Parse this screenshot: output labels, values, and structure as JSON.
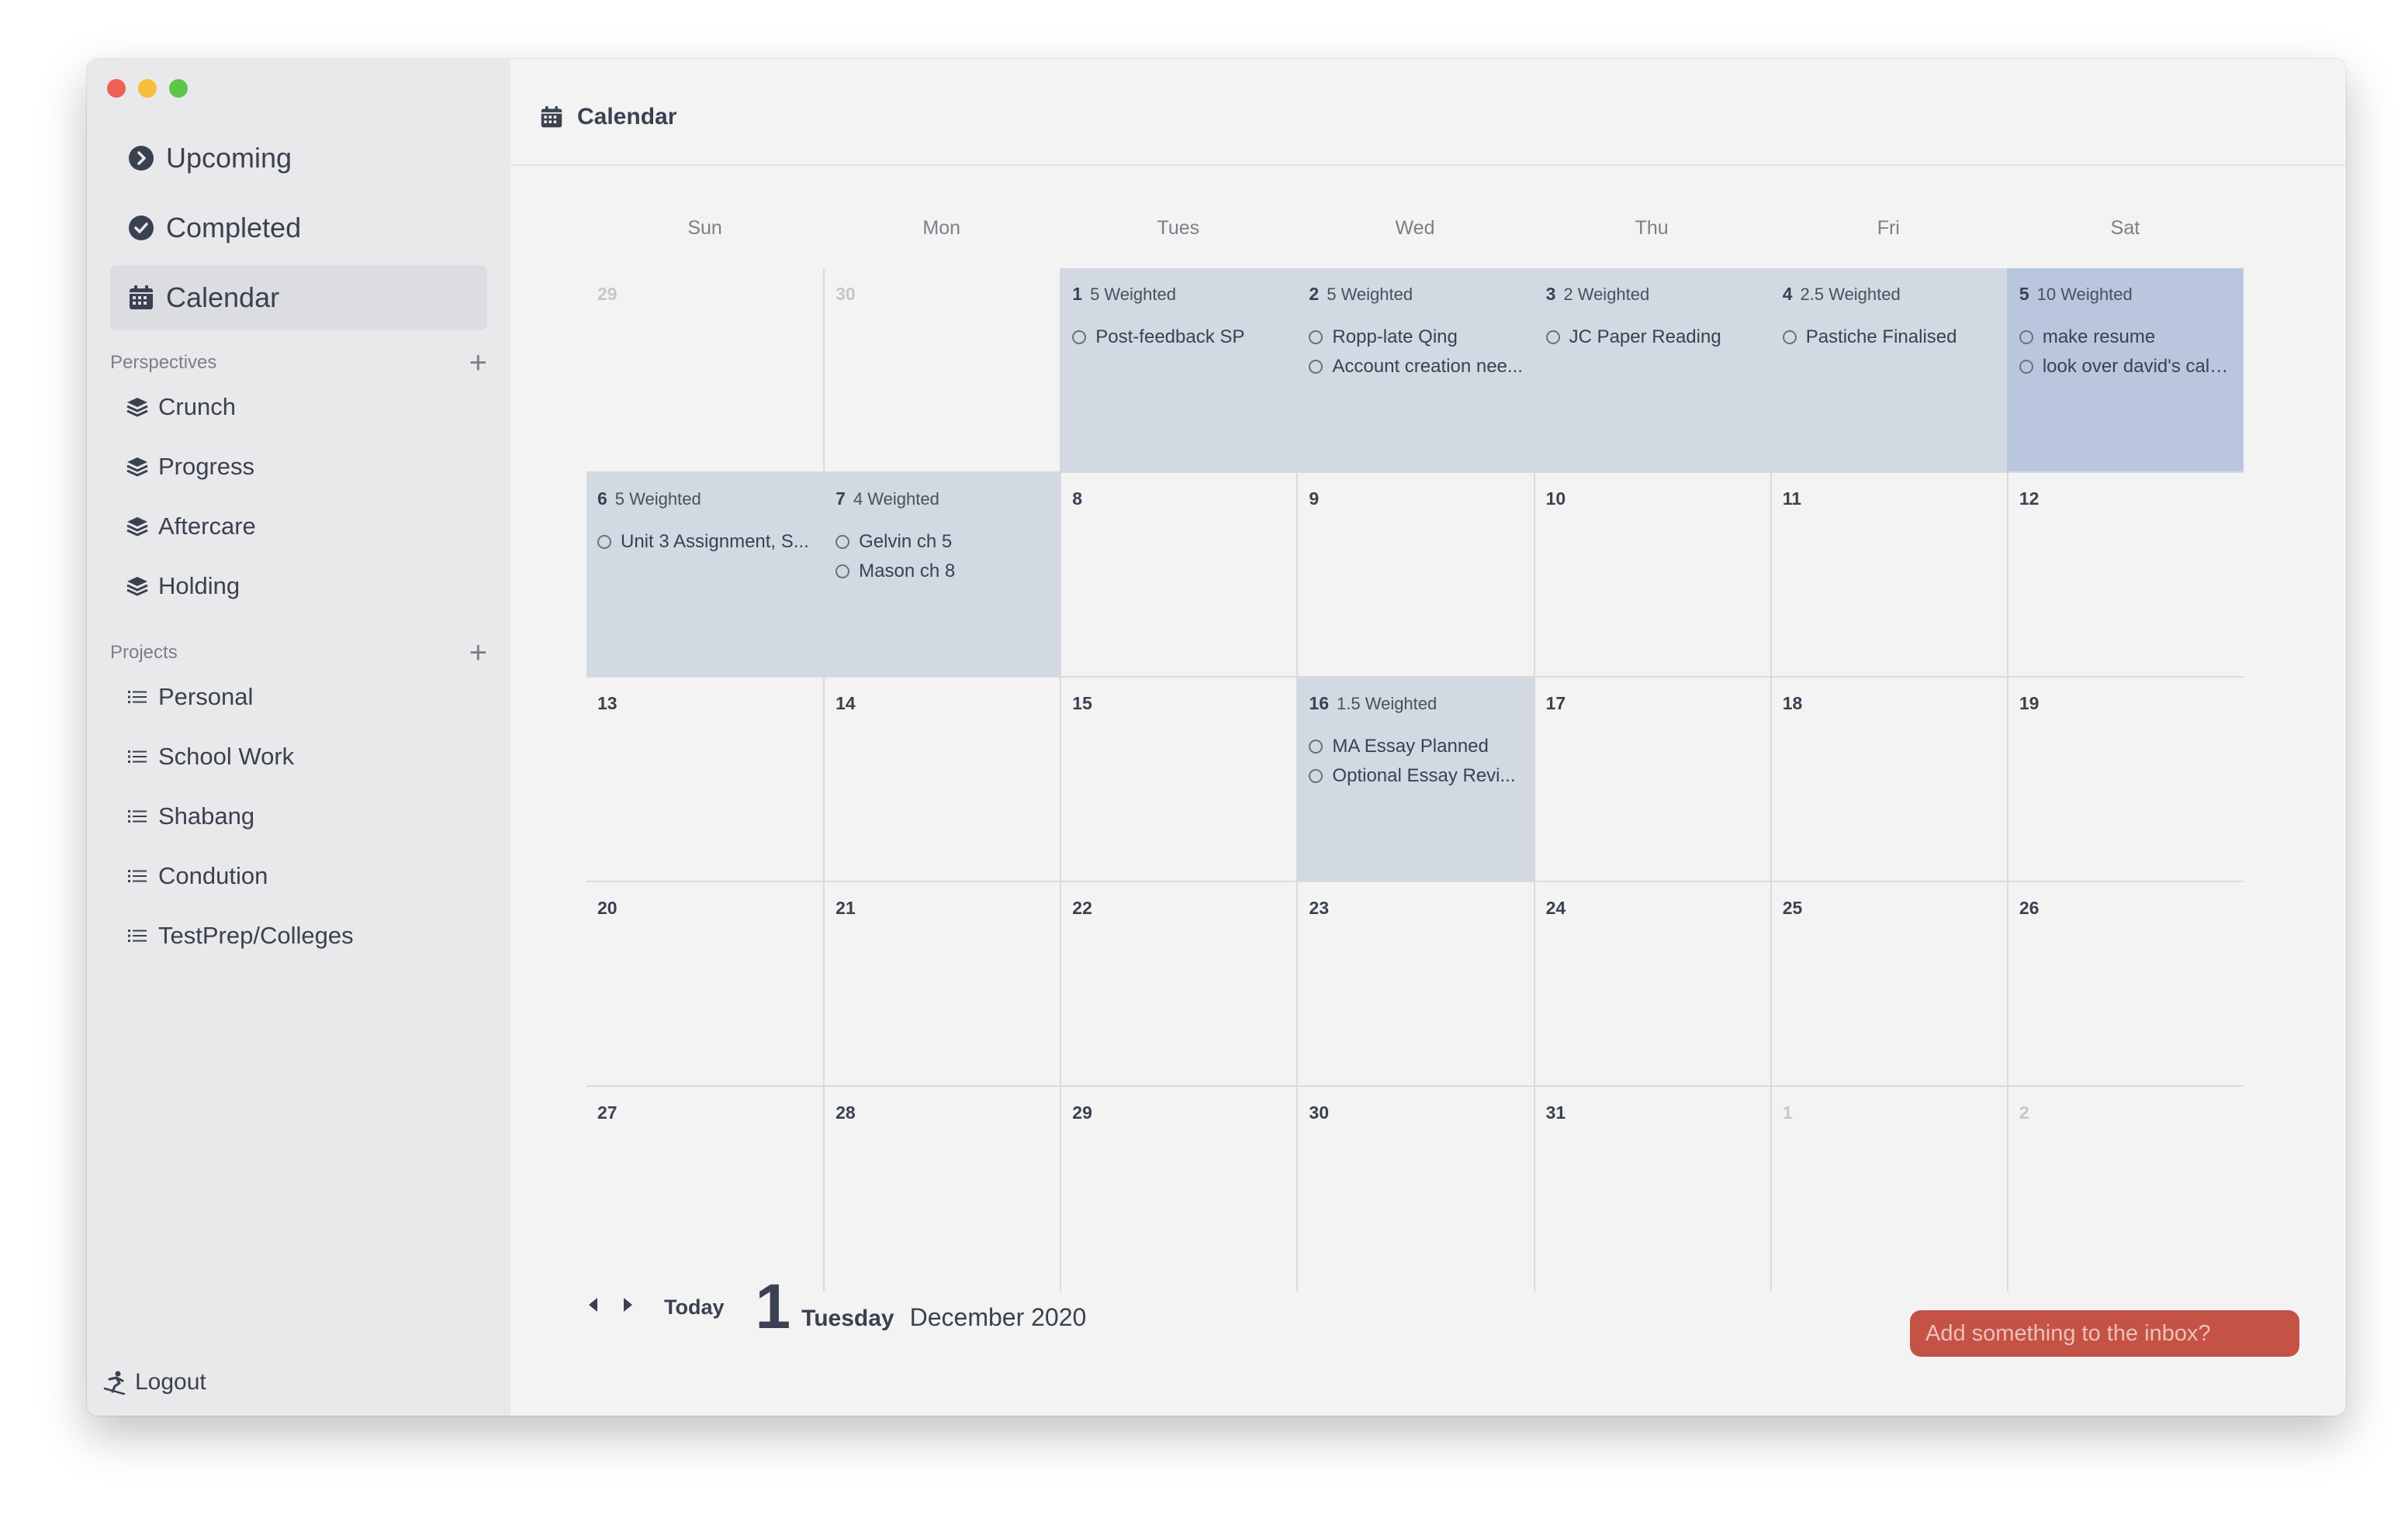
{
  "colors": {
    "accent": "#c45245",
    "sidebar_bg": "#e9e9eb",
    "weighted_cell": "#d3d9e2",
    "heavy_cell": "#b9c6de"
  },
  "sidebar": {
    "main_nav": [
      {
        "label": "Upcoming",
        "icon": "chevron-right-circle-icon"
      },
      {
        "label": "Completed",
        "icon": "check-circle-icon"
      },
      {
        "label": "Calendar",
        "icon": "calendar-icon",
        "active": true
      }
    ],
    "perspectives_heading": "Perspectives",
    "perspectives": [
      {
        "label": "Crunch",
        "icon": "layers-icon"
      },
      {
        "label": "Progress",
        "icon": "layers-icon"
      },
      {
        "label": "Aftercare",
        "icon": "layers-icon"
      },
      {
        "label": "Holding",
        "icon": "layers-icon"
      }
    ],
    "projects_heading": "Projects",
    "projects": [
      {
        "label": "Personal",
        "icon": "list-icon"
      },
      {
        "label": "School Work",
        "icon": "list-icon"
      },
      {
        "label": "Shabang",
        "icon": "list-icon"
      },
      {
        "label": "Condution",
        "icon": "list-icon"
      },
      {
        "label": "TestPrep/Colleges",
        "icon": "list-icon"
      }
    ],
    "logout_label": "Logout"
  },
  "header": {
    "title": "Calendar"
  },
  "calendar": {
    "weekdays": [
      "Sun",
      "Mon",
      "Tues",
      "Wed",
      "Thu",
      "Fri",
      "Sat"
    ],
    "weeks": [
      [
        {
          "day": "29",
          "muted": true
        },
        {
          "day": "30",
          "muted": true
        },
        {
          "day": "1",
          "weight": "5 Weighted",
          "level": 1,
          "tasks": [
            "Post-feedback SP"
          ]
        },
        {
          "day": "2",
          "weight": "5 Weighted",
          "level": 1,
          "tasks": [
            "Ropp-late Qing",
            "Account creation nee..."
          ]
        },
        {
          "day": "3",
          "weight": "2 Weighted",
          "level": 1,
          "tasks": [
            "JC Paper Reading"
          ]
        },
        {
          "day": "4",
          "weight": "2.5 Weighted",
          "level": 1,
          "tasks": [
            "Pastiche Finalised"
          ]
        },
        {
          "day": "5",
          "weight": "10 Weighted",
          "level": 2,
          "tasks": [
            "make resume",
            "look over david's calc..."
          ]
        }
      ],
      [
        {
          "day": "6",
          "weight": "5 Weighted",
          "level": 1,
          "tasks": [
            "Unit 3 Assignment, S..."
          ]
        },
        {
          "day": "7",
          "weight": "4 Weighted",
          "level": 1,
          "tasks": [
            "Gelvin ch 5",
            "Mason ch 8"
          ]
        },
        {
          "day": "8"
        },
        {
          "day": "9"
        },
        {
          "day": "10"
        },
        {
          "day": "11"
        },
        {
          "day": "12"
        }
      ],
      [
        {
          "day": "13"
        },
        {
          "day": "14"
        },
        {
          "day": "15"
        },
        {
          "day": "16",
          "weight": "1.5 Weighted",
          "level": 1,
          "tasks": [
            "MA Essay Planned",
            "Optional Essay Revi..."
          ]
        },
        {
          "day": "17"
        },
        {
          "day": "18"
        },
        {
          "day": "19"
        }
      ],
      [
        {
          "day": "20"
        },
        {
          "day": "21"
        },
        {
          "day": "22"
        },
        {
          "day": "23"
        },
        {
          "day": "24"
        },
        {
          "day": "25"
        },
        {
          "day": "26"
        }
      ],
      [
        {
          "day": "27"
        },
        {
          "day": "28"
        },
        {
          "day": "29"
        },
        {
          "day": "30"
        },
        {
          "day": "31"
        },
        {
          "day": "1",
          "muted": true
        },
        {
          "day": "2",
          "muted": true
        }
      ]
    ]
  },
  "footer": {
    "today_label": "Today",
    "selected_day": "1",
    "selected_weekday": "Tuesday",
    "month_year": "December 2020"
  },
  "inbox": {
    "placeholder": "Add something to the inbox?"
  }
}
